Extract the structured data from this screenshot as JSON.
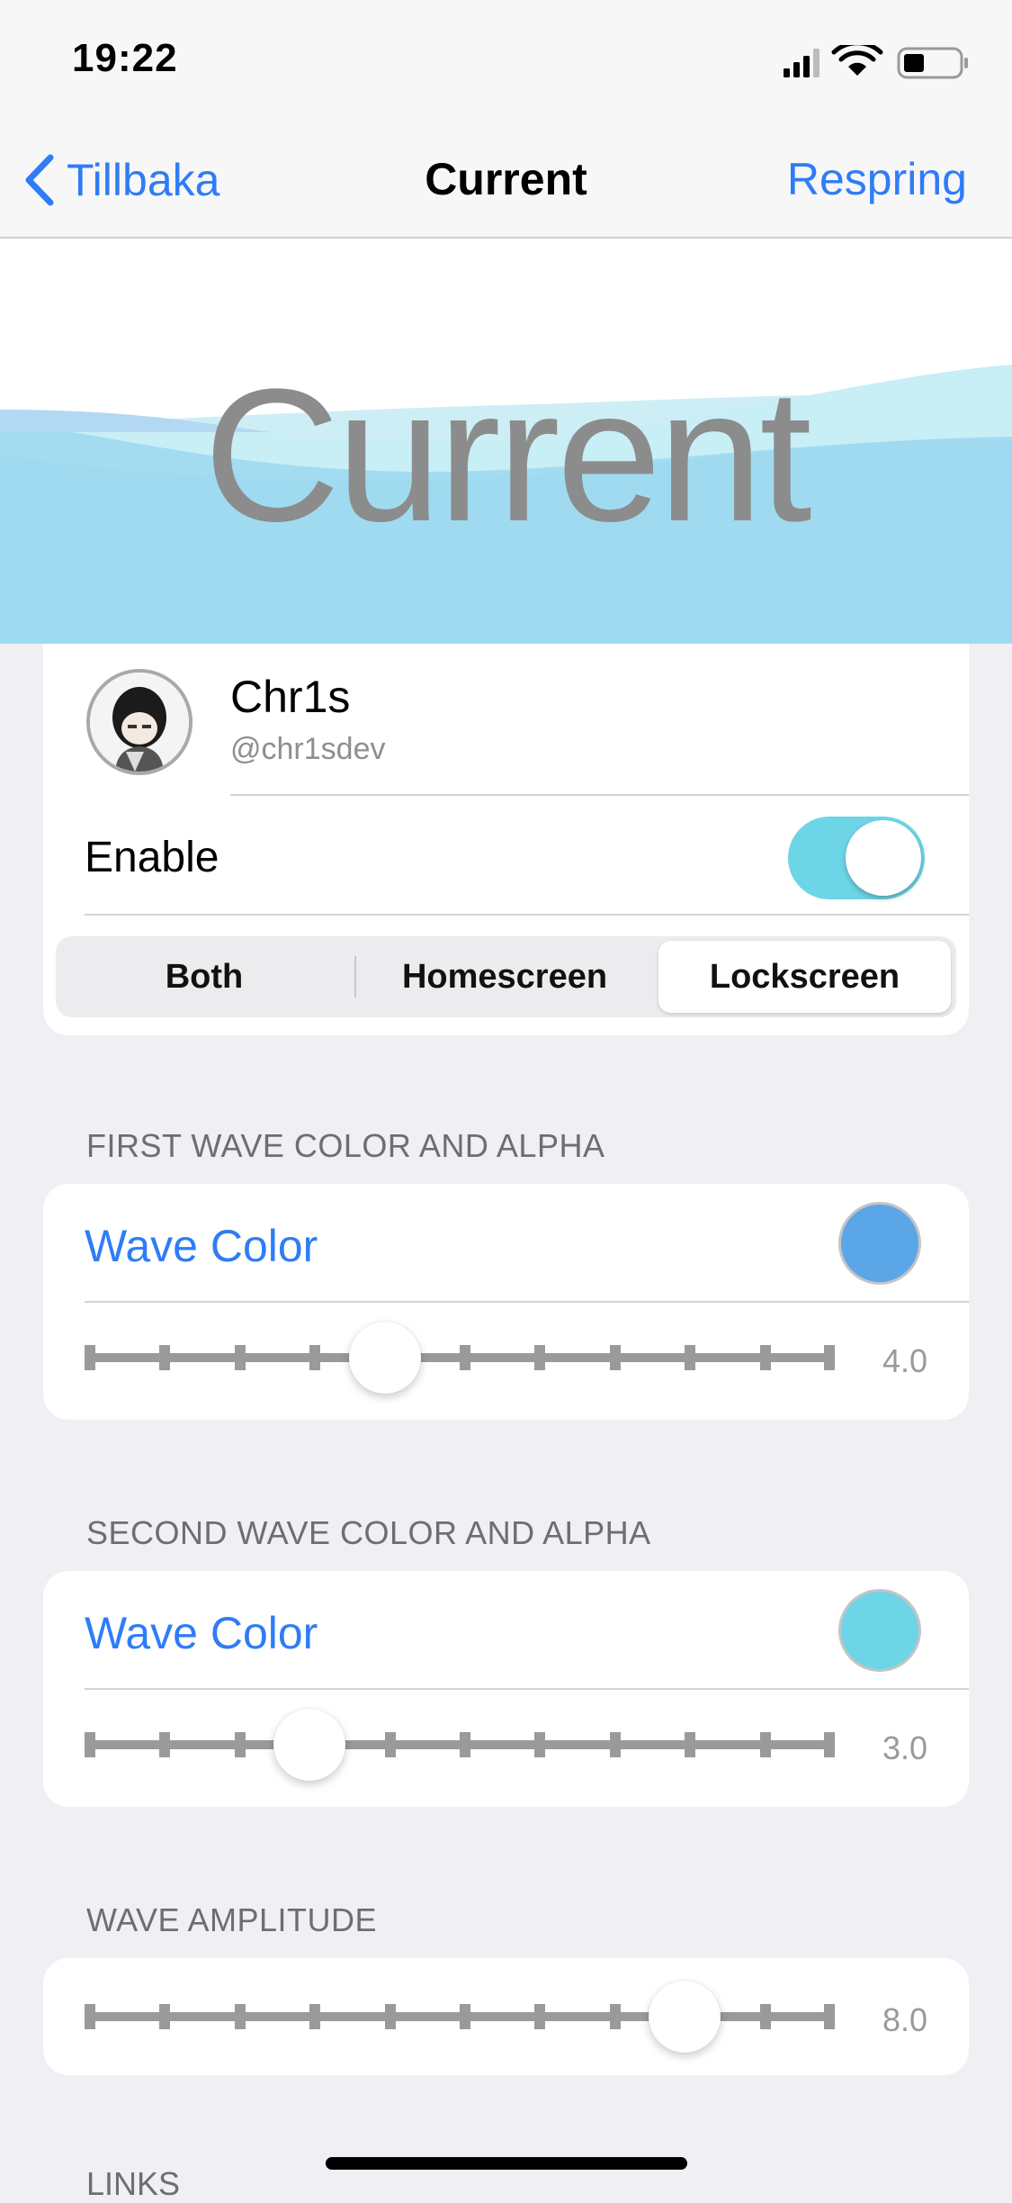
{
  "status": {
    "time": "19:22",
    "battery_percent": 35
  },
  "nav": {
    "back_label": "Tillbaka",
    "title": "Current",
    "right_label": "Respring"
  },
  "header": {
    "title": "Current"
  },
  "profile": {
    "name": "Chr1s",
    "handle": "@chr1sdev",
    "enable_label": "Enable",
    "enabled": true
  },
  "segments": {
    "items": [
      "Both",
      "Homescreen",
      "Lockscreen"
    ],
    "selected": "Lockscreen"
  },
  "first_wave": {
    "header": "FIRST WAVE COLOR AND ALPHA",
    "label": "Wave Color",
    "color": "#5aa6e6",
    "value": "4.0"
  },
  "second_wave": {
    "header": "SECOND WAVE COLOR AND ALPHA",
    "label": "Wave Color",
    "color": "#6dd5e5",
    "value": "3.0"
  },
  "amplitude": {
    "header": "WAVE AMPLITUDE",
    "value": "8.0"
  },
  "links": {
    "header": "LINKS"
  },
  "colors": {
    "accent": "#2f7cf6",
    "toggle_on": "#6dd5e5",
    "header_wave": "#9fdaf0"
  }
}
